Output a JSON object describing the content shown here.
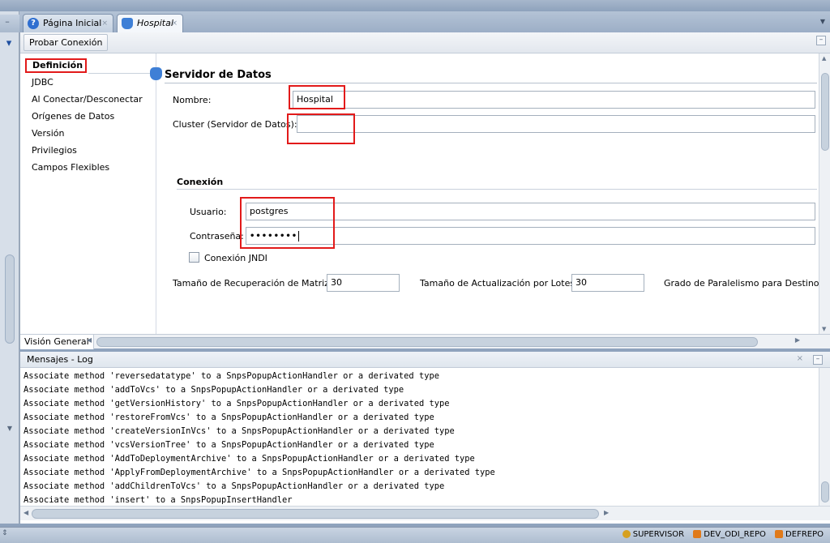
{
  "tabs": [
    {
      "label": "Página Inicial",
      "close": "×"
    },
    {
      "label": "Hospital",
      "close": "×"
    }
  ],
  "toolbar": {
    "test_connection": "Probar Conexión"
  },
  "nav": {
    "items": [
      "Definición",
      "JDBC",
      "Al Conectar/Desconectar",
      "Orígenes de Datos",
      "Versión",
      "Privilegios",
      "Campos Flexibles"
    ]
  },
  "form": {
    "section_title": "Servidor de Datos",
    "name_label": "Nombre:",
    "name_value": "Hospital",
    "cluster_label": "Cluster (Servidor de Datos):",
    "cluster_value": "",
    "connection_title": "Conexión",
    "user_label": "Usuario:",
    "user_value": "postgres",
    "password_label": "Contraseña:",
    "password_value": "••••••••",
    "jndi_label": "Conexión JNDI",
    "array_fetch_label": "Tamaño de Recuperación de Matriz:",
    "array_fetch_value": "30",
    "batch_update_label": "Tamaño de Actualización por Lotes:",
    "batch_update_value": "30",
    "parallelism_label": "Grado de Paralelismo para Destino:"
  },
  "bottom": {
    "overview_tab": "Visión General"
  },
  "log": {
    "title": "Mensajes - Log",
    "lines": [
      "Associate method 'reversedatatype' to a SnpsPopupActionHandler or a derivated type",
      "Associate method 'addToVcs' to a SnpsPopupActionHandler or a derivated type",
      "Associate method 'getVersionHistory' to a SnpsPopupActionHandler or a derivated type",
      "Associate method 'restoreFromVcs' to a SnpsPopupActionHandler or a derivated type",
      "Associate method 'createVersionInVcs' to a SnpsPopupActionHandler or a derivated type",
      "Associate method 'vcsVersionTree' to a SnpsPopupActionHandler or a derivated type",
      "Associate method 'AddToDeploymentArchive' to a SnpsPopupActionHandler or a derivated type",
      "Associate method 'ApplyFromDeploymentArchive' to a SnpsPopupActionHandler or a derivated type",
      "Associate method 'addChildrenToVcs' to a SnpsPopupActionHandler or a derivated type",
      "Associate method 'insert' to a SnpsPopupInsertHandler"
    ]
  },
  "status": {
    "user": "SUPERVISOR",
    "repo1": "DEV_ODI_REPO",
    "repo2": "DEFREPO"
  }
}
